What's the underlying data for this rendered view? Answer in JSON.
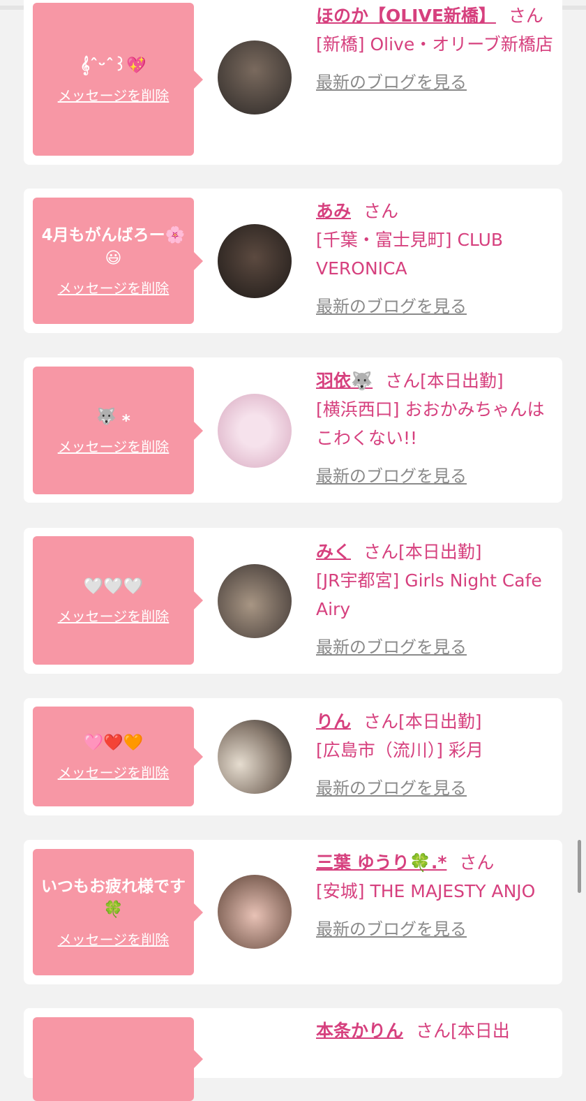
{
  "cards": [
    {
      "message": "𝄞ˆᵕˆ꒱💖",
      "delete_label": "メッセージを削除",
      "name": "ほのか【OLIVE新橋】",
      "honorific": "さん",
      "status": "",
      "shop": "[新橋] Olive・オリーブ新橋店",
      "blog_label": "最新のブログを見る",
      "avatar_colors": [
        "#7a6a5e",
        "#2e2a28"
      ]
    },
    {
      "message": "4月もがんばろー🌸😃",
      "delete_label": "メッセージを削除",
      "name": "あみ",
      "honorific": "さん",
      "status": "",
      "shop": "[千葉・富士見町] CLUB VERONICA",
      "blog_label": "最新のブログを見る",
      "avatar_colors": [
        "#5c4a40",
        "#1e1a18"
      ]
    },
    {
      "message": "🐺 ⁎",
      "delete_label": "メッセージを削除",
      "name": "羽依🐺",
      "honorific": "さん",
      "status": "[本日出勤]",
      "shop": "[横浜西口] おおかみちゃんはこわくない!!",
      "blog_label": "最新のブログを見る",
      "avatar_colors": [
        "#f6e2ec",
        "#d8a9c0"
      ]
    },
    {
      "message": "🤍🤍🤍",
      "delete_label": "メッセージを削除",
      "name": "みく",
      "honorific": "さん",
      "status": "[本日出勤]",
      "shop": "[JR宇都宮] Girls Night Cafe Airy",
      "blog_label": "最新のブログを見る",
      "avatar_colors": [
        "#a89684",
        "#3a3230"
      ]
    },
    {
      "message": "🩷❤️🧡",
      "delete_label": "メッセージを削除",
      "name": "りん",
      "honorific": "さん",
      "status": "[本日出勤]",
      "shop": "[広島市（流川）] 彩月",
      "blog_label": "最新のブログを見る",
      "avatar_colors": [
        "#e6ddd0",
        "#2a2624"
      ]
    },
    {
      "message": "いつもお疲れ様です🍀",
      "delete_label": "メッセージを削除",
      "name": "三葉 ゆうり🍀.*",
      "honorific": "さん",
      "status": "",
      "shop": "[安城] THE MAJESTY ANJO",
      "blog_label": "最新のブログを見る",
      "avatar_colors": [
        "#e8c2b6",
        "#5a4034"
      ]
    },
    {
      "message": "",
      "delete_label": "",
      "name": "本条かりん",
      "honorific": "さん",
      "status": "[本日出",
      "shop": "",
      "blog_label": "",
      "avatar_colors": [
        "#ffffff",
        "#ffffff"
      ]
    }
  ]
}
